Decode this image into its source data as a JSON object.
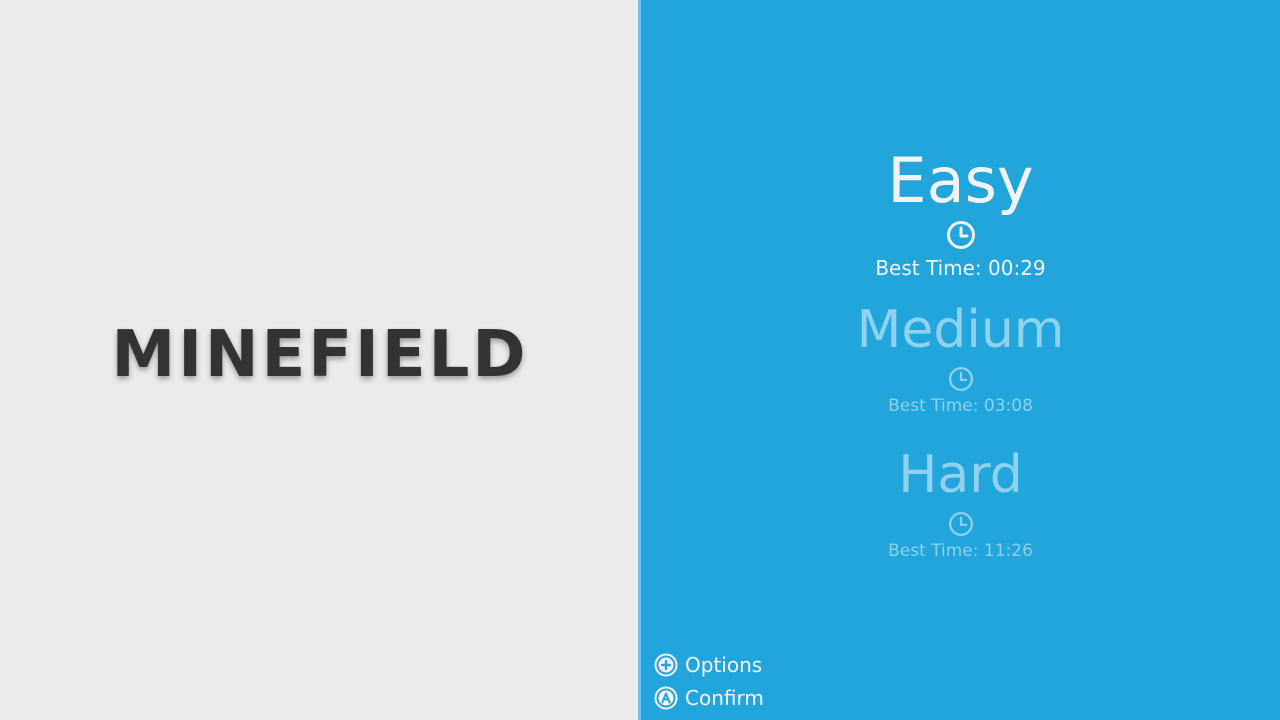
{
  "title": "MINEFIELD",
  "difficulties": [
    {
      "name": "Easy",
      "best_time": "Best Time: 00:29",
      "selected": true,
      "icon": "clock-icon"
    },
    {
      "name": "Medium",
      "best_time": "Best Time: 03:08",
      "selected": false,
      "icon": "clock-icon"
    },
    {
      "name": "Hard",
      "best_time": "Best Time: 11:26",
      "selected": false,
      "icon": "clock-icon"
    }
  ],
  "hints": {
    "options": {
      "label": "Options",
      "icon": "plus-button-icon"
    },
    "confirm": {
      "label": "Confirm",
      "icon": "a-button-icon"
    }
  },
  "colors": {
    "left_background": "#ebebeb",
    "right_background": "#21a5da",
    "title_text": "#333333",
    "selected_text": "#f2f2f2",
    "unselected_text": "#8fd1ee"
  }
}
